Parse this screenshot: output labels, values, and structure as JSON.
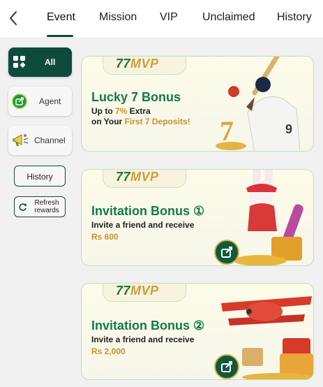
{
  "nav": {
    "tabs": [
      {
        "label": "Event"
      },
      {
        "label": "Mission"
      },
      {
        "label": "VIP"
      },
      {
        "label": "Unclaimed"
      },
      {
        "label": "History"
      }
    ],
    "active_tab": "Event"
  },
  "sidebar": {
    "items": [
      {
        "label": "All",
        "icon": "grid-icon"
      },
      {
        "label": "Agent",
        "icon": "share-icon"
      },
      {
        "label": "Channel",
        "icon": "megaphone-icon"
      }
    ],
    "history_label": "History",
    "refresh_label": "Refresh rewards"
  },
  "cards": [
    {
      "brand_num": "77",
      "brand_text": "MVP",
      "title": "Lucky 7 Bonus",
      "line1_pre": "Up to ",
      "line1_hl": "7%",
      "line1_post": " Extra",
      "line2_pre": "on Your ",
      "line2_hl": "First 7 Deposits!",
      "art": "cricket-batsman"
    },
    {
      "brand_num": "77",
      "brand_text": "MVP",
      "title": "Invitation Bonus ①",
      "line1": "Invite a friend and receive",
      "amount": "Rs 600",
      "art": "rabbit-skateboard"
    },
    {
      "brand_num": "77",
      "brand_text": "MVP",
      "title": "Invitation Bonus ②",
      "line1": "Invite a friend and receive",
      "amount": "Rs 2,000",
      "art": "red-airplane"
    }
  ],
  "colors": {
    "primary": "#0e4b3b",
    "title_green": "#137a4b",
    "gold": "#c8912a"
  }
}
